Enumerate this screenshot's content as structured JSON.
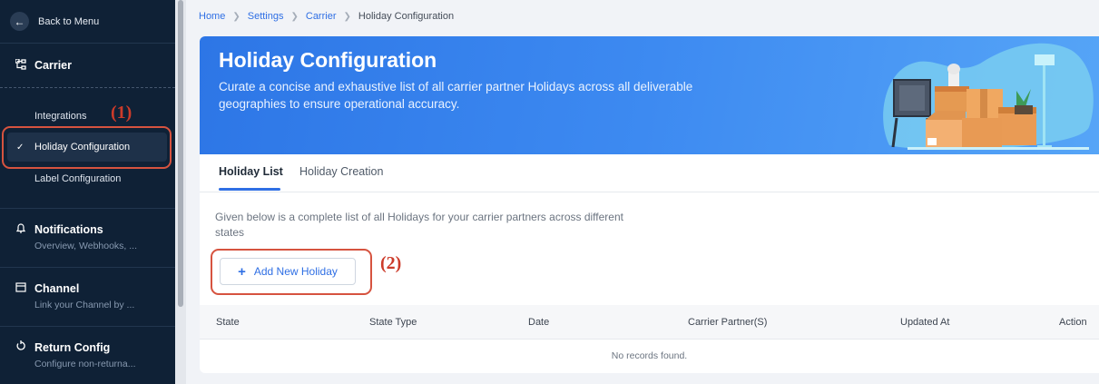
{
  "sidebar": {
    "back_label": "Back to Menu",
    "carrier": {
      "title": "Carrier",
      "items": [
        {
          "label": "Integrations"
        },
        {
          "label": "Holiday Configuration",
          "active": true
        },
        {
          "label": "Label Configuration"
        }
      ]
    },
    "groups": [
      {
        "title": "Notifications",
        "desc": "Overview, Webhooks, ...",
        "icon": "bell-icon"
      },
      {
        "title": "Channel",
        "desc": "Link your Channel by ...",
        "icon": "store-icon"
      },
      {
        "title": "Return Config",
        "desc": "Configure non-returna...",
        "icon": "return-icon"
      }
    ]
  },
  "breadcrumb": {
    "items": [
      "Home",
      "Settings",
      "Carrier"
    ],
    "current": "Holiday Configuration"
  },
  "banner": {
    "title": "Holiday Configuration",
    "subtitle": "Curate a concise and exhaustive list of all carrier partner Holidays across all deliverable geographies to ensure operational accuracy."
  },
  "tabs": [
    {
      "label": "Holiday List",
      "active": true
    },
    {
      "label": "Holiday Creation",
      "active": false
    }
  ],
  "content": {
    "description": "Given below is a complete list of all Holidays for your carrier partners across different states",
    "add_button": "Add New Holiday"
  },
  "table": {
    "columns": [
      "State",
      "State Type",
      "Date",
      "Carrier Partner(S)",
      "Updated At",
      "Action"
    ],
    "empty_message": "No records found."
  },
  "annotations": {
    "label_1": "(1)",
    "label_2": "(2)"
  },
  "colors": {
    "sidebar_bg": "#0f2136",
    "accent": "#2f6fe4",
    "annotation": "#d6533f"
  }
}
